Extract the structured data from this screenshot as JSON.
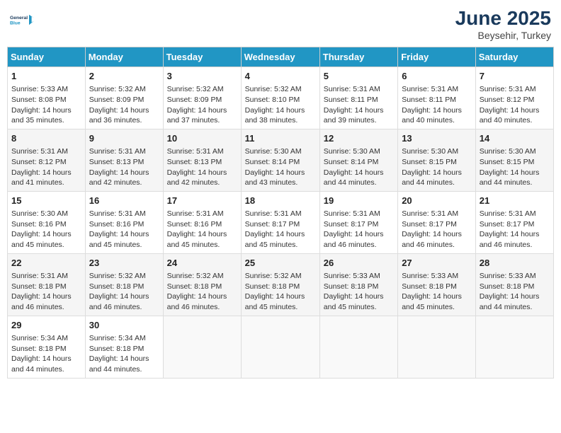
{
  "header": {
    "logo_line1": "General",
    "logo_line2": "Blue",
    "month": "June 2025",
    "location": "Beysehir, Turkey"
  },
  "days_of_week": [
    "Sunday",
    "Monday",
    "Tuesday",
    "Wednesday",
    "Thursday",
    "Friday",
    "Saturday"
  ],
  "weeks": [
    [
      {
        "day": "1",
        "content": "Sunrise: 5:33 AM\nSunset: 8:08 PM\nDaylight: 14 hours\nand 35 minutes."
      },
      {
        "day": "2",
        "content": "Sunrise: 5:32 AM\nSunset: 8:09 PM\nDaylight: 14 hours\nand 36 minutes."
      },
      {
        "day": "3",
        "content": "Sunrise: 5:32 AM\nSunset: 8:09 PM\nDaylight: 14 hours\nand 37 minutes."
      },
      {
        "day": "4",
        "content": "Sunrise: 5:32 AM\nSunset: 8:10 PM\nDaylight: 14 hours\nand 38 minutes."
      },
      {
        "day": "5",
        "content": "Sunrise: 5:31 AM\nSunset: 8:11 PM\nDaylight: 14 hours\nand 39 minutes."
      },
      {
        "day": "6",
        "content": "Sunrise: 5:31 AM\nSunset: 8:11 PM\nDaylight: 14 hours\nand 40 minutes."
      },
      {
        "day": "7",
        "content": "Sunrise: 5:31 AM\nSunset: 8:12 PM\nDaylight: 14 hours\nand 40 minutes."
      }
    ],
    [
      {
        "day": "8",
        "content": "Sunrise: 5:31 AM\nSunset: 8:12 PM\nDaylight: 14 hours\nand 41 minutes."
      },
      {
        "day": "9",
        "content": "Sunrise: 5:31 AM\nSunset: 8:13 PM\nDaylight: 14 hours\nand 42 minutes."
      },
      {
        "day": "10",
        "content": "Sunrise: 5:31 AM\nSunset: 8:13 PM\nDaylight: 14 hours\nand 42 minutes."
      },
      {
        "day": "11",
        "content": "Sunrise: 5:30 AM\nSunset: 8:14 PM\nDaylight: 14 hours\nand 43 minutes."
      },
      {
        "day": "12",
        "content": "Sunrise: 5:30 AM\nSunset: 8:14 PM\nDaylight: 14 hours\nand 44 minutes."
      },
      {
        "day": "13",
        "content": "Sunrise: 5:30 AM\nSunset: 8:15 PM\nDaylight: 14 hours\nand 44 minutes."
      },
      {
        "day": "14",
        "content": "Sunrise: 5:30 AM\nSunset: 8:15 PM\nDaylight: 14 hours\nand 44 minutes."
      }
    ],
    [
      {
        "day": "15",
        "content": "Sunrise: 5:30 AM\nSunset: 8:16 PM\nDaylight: 14 hours\nand 45 minutes."
      },
      {
        "day": "16",
        "content": "Sunrise: 5:31 AM\nSunset: 8:16 PM\nDaylight: 14 hours\nand 45 minutes."
      },
      {
        "day": "17",
        "content": "Sunrise: 5:31 AM\nSunset: 8:16 PM\nDaylight: 14 hours\nand 45 minutes."
      },
      {
        "day": "18",
        "content": "Sunrise: 5:31 AM\nSunset: 8:17 PM\nDaylight: 14 hours\nand 45 minutes."
      },
      {
        "day": "19",
        "content": "Sunrise: 5:31 AM\nSunset: 8:17 PM\nDaylight: 14 hours\nand 46 minutes."
      },
      {
        "day": "20",
        "content": "Sunrise: 5:31 AM\nSunset: 8:17 PM\nDaylight: 14 hours\nand 46 minutes."
      },
      {
        "day": "21",
        "content": "Sunrise: 5:31 AM\nSunset: 8:17 PM\nDaylight: 14 hours\nand 46 minutes."
      }
    ],
    [
      {
        "day": "22",
        "content": "Sunrise: 5:31 AM\nSunset: 8:18 PM\nDaylight: 14 hours\nand 46 minutes."
      },
      {
        "day": "23",
        "content": "Sunrise: 5:32 AM\nSunset: 8:18 PM\nDaylight: 14 hours\nand 46 minutes."
      },
      {
        "day": "24",
        "content": "Sunrise: 5:32 AM\nSunset: 8:18 PM\nDaylight: 14 hours\nand 46 minutes."
      },
      {
        "day": "25",
        "content": "Sunrise: 5:32 AM\nSunset: 8:18 PM\nDaylight: 14 hours\nand 45 minutes."
      },
      {
        "day": "26",
        "content": "Sunrise: 5:33 AM\nSunset: 8:18 PM\nDaylight: 14 hours\nand 45 minutes."
      },
      {
        "day": "27",
        "content": "Sunrise: 5:33 AM\nSunset: 8:18 PM\nDaylight: 14 hours\nand 45 minutes."
      },
      {
        "day": "28",
        "content": "Sunrise: 5:33 AM\nSunset: 8:18 PM\nDaylight: 14 hours\nand 44 minutes."
      }
    ],
    [
      {
        "day": "29",
        "content": "Sunrise: 5:34 AM\nSunset: 8:18 PM\nDaylight: 14 hours\nand 44 minutes."
      },
      {
        "day": "30",
        "content": "Sunrise: 5:34 AM\nSunset: 8:18 PM\nDaylight: 14 hours\nand 44 minutes."
      },
      {
        "day": "",
        "content": ""
      },
      {
        "day": "",
        "content": ""
      },
      {
        "day": "",
        "content": ""
      },
      {
        "day": "",
        "content": ""
      },
      {
        "day": "",
        "content": ""
      }
    ]
  ]
}
